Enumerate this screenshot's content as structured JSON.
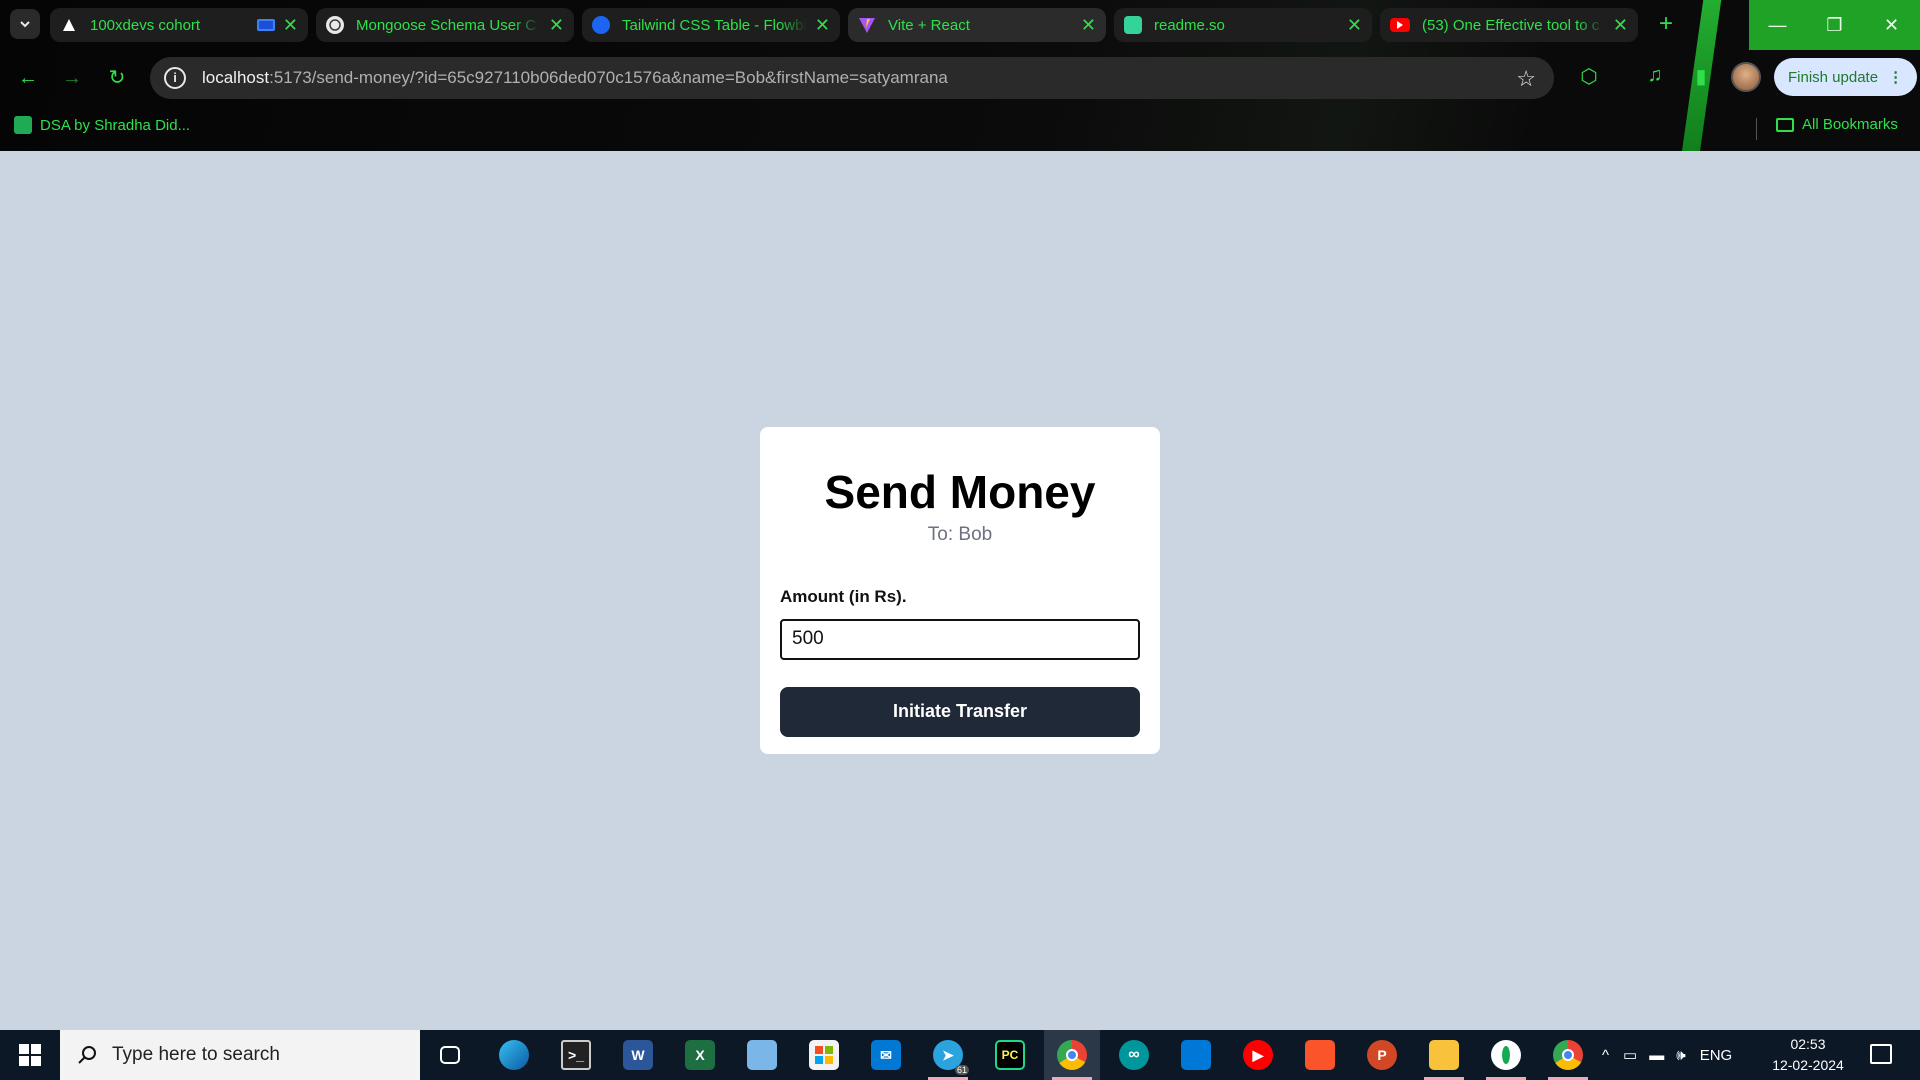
{
  "browser": {
    "tabs": [
      {
        "title": "100xdevs cohort",
        "favicon": "triangle-icon"
      },
      {
        "title": "Mongoose Schema User C",
        "favicon": "chatgpt-icon"
      },
      {
        "title": "Tailwind CSS Table - Flowbi",
        "favicon": "flowbite-icon"
      },
      {
        "title": "Vite + React",
        "favicon": "vite-icon"
      },
      {
        "title": "readme.so",
        "favicon": "readme-icon"
      },
      {
        "title": "(53) One Effective tool to c",
        "favicon": "youtube-icon"
      }
    ],
    "url_host": "localhost",
    "url_rest": ":5173/send-money/?id=65c927110b06ded070c1576a&name=Bob&firstName=satyamrana",
    "finish_update_label": "Finish update",
    "bookmarks": [
      {
        "label": "DSA by Shradha Did..."
      }
    ],
    "all_bookmarks_label": "All Bookmarks",
    "accent_color": "#2fe04b"
  },
  "page": {
    "title": "Send Money",
    "recipient": "To: Bob",
    "amount_label": "Amount (in Rs).",
    "amount_value": "500",
    "submit_label": "Initiate Transfer",
    "background_color": "#cbd5e1",
    "button_color": "#1f2937"
  },
  "taskbar": {
    "search_placeholder": "Type here to search",
    "telegram_badge": "61",
    "language": "ENG",
    "time": "02:53",
    "date": "12-02-2024"
  }
}
